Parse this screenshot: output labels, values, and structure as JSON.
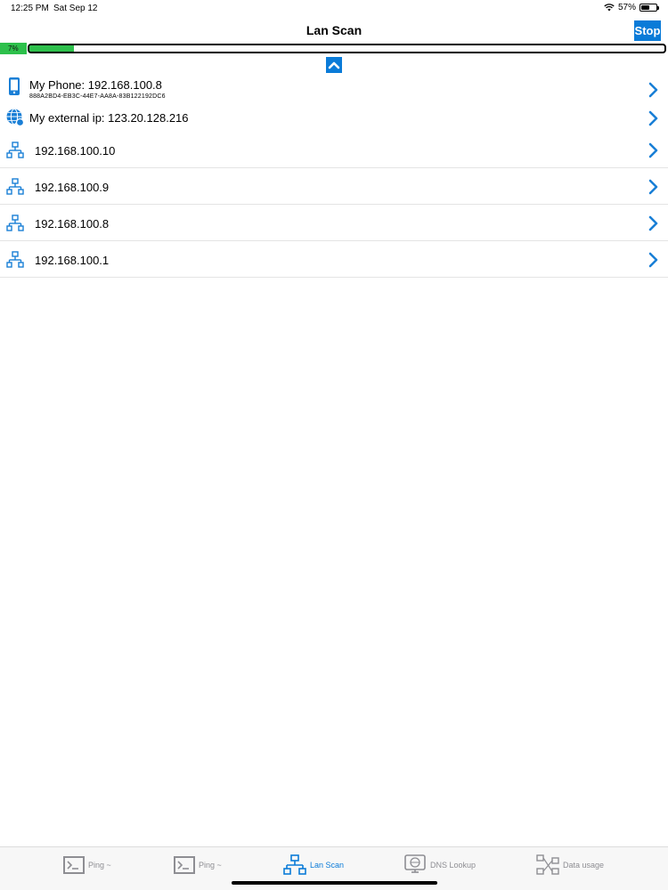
{
  "status_bar": {
    "time": "12:25 PM",
    "date": "Sat Sep 12",
    "battery": "57%",
    "battery_level": 0.57
  },
  "nav": {
    "title": "Lan Scan",
    "stop_label": "Stop"
  },
  "progress": {
    "label": "7%",
    "value": 0.07
  },
  "my_phone": {
    "title": "My Phone:  192.168.100.8",
    "subtitle": "888A2BD4-EB3C-44E7-AA8A-83B122192DC6"
  },
  "external_ip": {
    "text": "My external ip: 123.20.128.216"
  },
  "hosts": [
    "192.168.100.10",
    "192.168.100.9",
    "192.168.100.8",
    "192.168.100.1"
  ],
  "tabs": [
    {
      "label": "Ping ~",
      "icon": "terminal-icon",
      "active": false
    },
    {
      "label": "Ping ~",
      "icon": "terminal-icon",
      "active": false
    },
    {
      "label": "Lan Scan",
      "icon": "network-icon",
      "active": true
    },
    {
      "label": "DNS Lookup",
      "icon": "dns-icon",
      "active": false
    },
    {
      "label": "Data usage",
      "icon": "data-usage-icon",
      "active": false
    }
  ],
  "colors": {
    "accent": "#0a7bd8",
    "progress": "#2dc04b",
    "inactive_tab": "#8e8e93"
  }
}
